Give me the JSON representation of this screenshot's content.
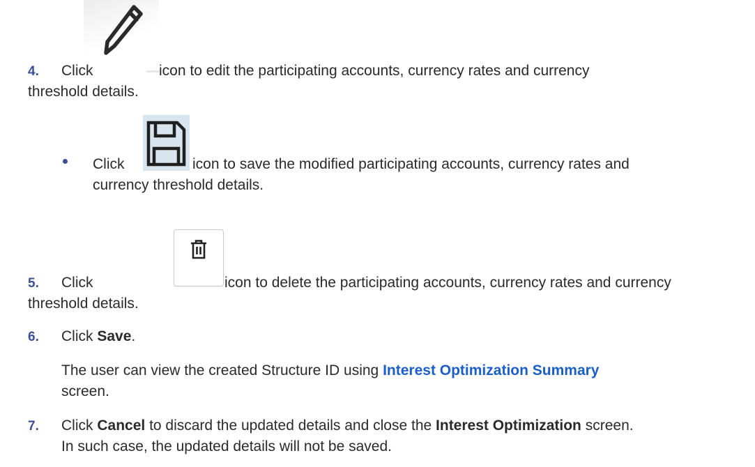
{
  "steps": {
    "step4": {
      "number": "4.",
      "click": "Click",
      "line1": "icon to edit the participating accounts, currency rates and currency",
      "line2": "threshold details.",
      "icon": "pencil-icon"
    },
    "bullet_save": {
      "click": "Click",
      "line1": "icon to save the modified participating accounts, currency rates and",
      "line2": "currency threshold details.",
      "icon": "floppy-disk-icon"
    },
    "step5": {
      "number": "5.",
      "click": "Click",
      "line1": "icon to delete the participating accounts, currency rates and currency",
      "line2": "threshold details.",
      "icon": "trash-icon"
    },
    "step6": {
      "number": "6.",
      "click": "Click",
      "bold": "Save",
      "end": ".",
      "para_before": "The user can view the created Structure ID using",
      "link": "Interest Optimization Summary",
      "para_after": "screen."
    },
    "step7": {
      "number": "7.",
      "click": "Click",
      "bold1": "Cancel",
      "middle": "to discard the updated details and close the",
      "bold2": "Interest Optimization",
      "tail": "screen.",
      "line2": "In such case, the updated details will not be saved."
    }
  },
  "colors": {
    "step_number": "#3b4f9a",
    "link": "#1a5ec9",
    "save_icon_bg": "#d9e5ee",
    "icon_stroke": "#1f1f1f"
  }
}
